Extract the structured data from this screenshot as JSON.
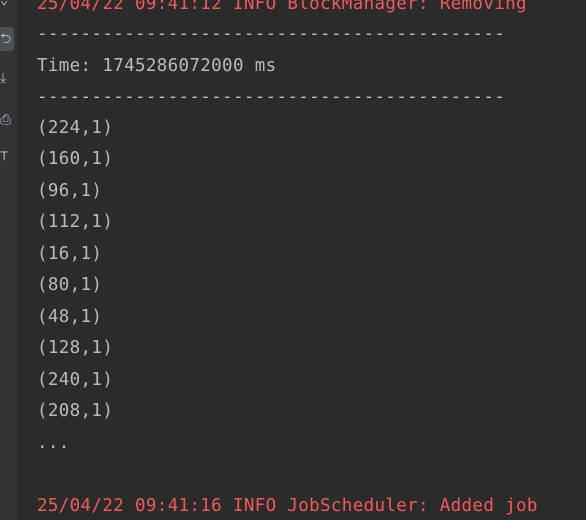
{
  "console": {
    "log_top": "25/04/22 09:41:12 INFO BlockManager: Removing",
    "separator_top": "-------------------------------------------",
    "time_line": "Time: 1745286072000 ms",
    "separator_bottom": "-------------------------------------------",
    "results": [
      "(224,1)",
      "(160,1)",
      "(96,1)",
      "(112,1)",
      "(16,1)",
      "(80,1)",
      "(48,1)",
      "(128,1)",
      "(240,1)",
      "(208,1)"
    ],
    "ellipsis": "...",
    "log_bottom": "25/04/22 09:41:16 INFO JobScheduler: Added job"
  },
  "colors": {
    "background": "#2b2b2b",
    "gutter": "#313335",
    "text": "#bbbbbb",
    "log_red": "#f25a5a"
  },
  "gutter_icons": [
    "scroll-down-icon",
    "soft-wrap-icon",
    "scroll-to-end-icon",
    "print-icon",
    "trash-icon"
  ]
}
